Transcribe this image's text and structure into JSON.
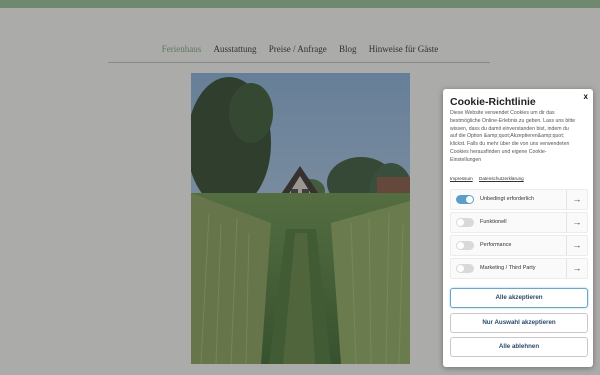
{
  "nav": {
    "items": [
      {
        "label": "Ferienhaus",
        "active": true
      },
      {
        "label": "Ausstattung",
        "active": false
      },
      {
        "label": "Preise / Anfrage",
        "active": false
      },
      {
        "label": "Blog",
        "active": false
      },
      {
        "label": "Hinweise für Gäste",
        "active": false
      }
    ]
  },
  "cookie": {
    "close": "x",
    "title": "Cookie-Richtlinie",
    "text": "Diese Website verwendet Cookies um dir das bestmögliche Online-Erlebnis zu geben. Lass uns bitte wissen, dass du damit einverstanden bist, indem du auf die Option &amp;quot;Akzeptieren&amp;quot; klickst. Falls du mehr über die von uns verwendeten Cookies herausfinden und eigene Cookie-Einstellungen",
    "links": {
      "impressum": "Impressum",
      "datenschutz": "Datenschutzerklärung"
    },
    "toggles": [
      {
        "label": "Unbedingt erforderlich",
        "on": true
      },
      {
        "label": "Funktionell",
        "on": false
      },
      {
        "label": "Performance",
        "on": false
      },
      {
        "label": "Marketing / Third Party",
        "on": false
      }
    ],
    "arrow": "→",
    "buttons": {
      "accept_all": "Alle akzeptieren",
      "accept_selection": "Nur Auswahl akzeptieren",
      "reject_all": "Alle ablehnen"
    }
  },
  "colors": {
    "accent": "#8fb78f",
    "toggle_on": "#5b9fc7"
  }
}
